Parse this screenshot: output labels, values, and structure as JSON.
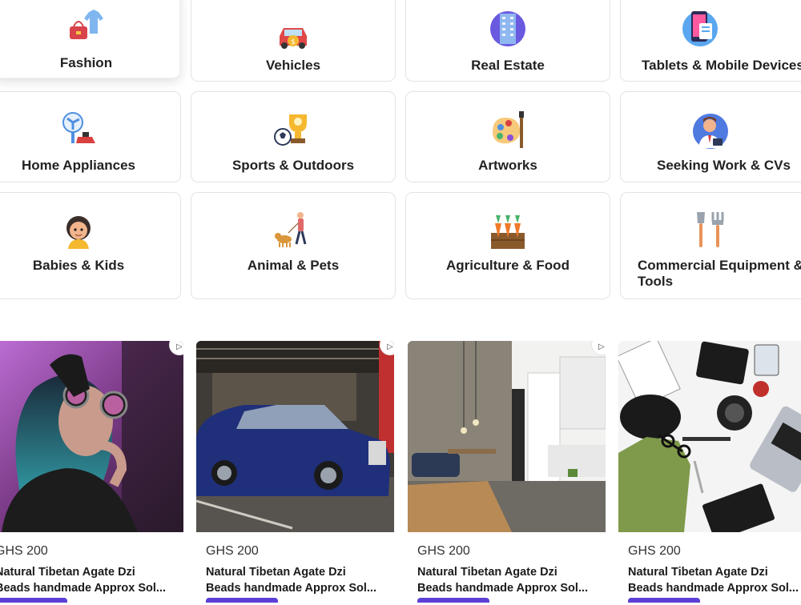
{
  "categories": [
    {
      "label": "Fashion",
      "icon": "fashion-icon"
    },
    {
      "label": "Vehicles",
      "icon": "car-icon"
    },
    {
      "label": "Real Estate",
      "icon": "building-icon"
    },
    {
      "label": "Tablets & Mobile Devices",
      "icon": "phone-icon"
    },
    {
      "label": "Home Appliances",
      "icon": "appliance-icon"
    },
    {
      "label": "Sports & Outdoors",
      "icon": "trophy-icon"
    },
    {
      "label": "Artworks",
      "icon": "palette-icon"
    },
    {
      "label": "Seeking Work & CVs",
      "icon": "worker-icon"
    },
    {
      "label": "Babies & Kids",
      "icon": "baby-icon"
    },
    {
      "label": "Animal & Pets",
      "icon": "dog-walker-icon"
    },
    {
      "label": "Agriculture & Food",
      "icon": "carrots-icon"
    },
    {
      "label": "Commercial Equipment & Tools",
      "icon": "tools-icon"
    }
  ],
  "products": [
    {
      "price": "GHS 200",
      "title_line1": "Natural Tibetan Agate Dzi",
      "title_line2": "Beads handmade Approx Sol...",
      "image": "woman-neon-glasses-photo"
    },
    {
      "price": "GHS 200",
      "title_line1": "Natural Tibetan Agate Dzi",
      "title_line2": "Beads handmade Approx Sol...",
      "image": "blue-luxury-car-photo"
    },
    {
      "price": "GHS 200",
      "title_line1": "Natural Tibetan Agate Dzi",
      "title_line2": "Beads handmade Approx Sol...",
      "image": "modern-interior-photo"
    },
    {
      "price": "GHS 200",
      "title_line1": "Natural Tibetan Agate Dzi",
      "title_line2": "Beads handmade Approx Sol...",
      "image": "flatlay-gadgets-photo"
    }
  ],
  "colors": {
    "accent": "#5b3fd6",
    "border": "#e3e3e3"
  }
}
